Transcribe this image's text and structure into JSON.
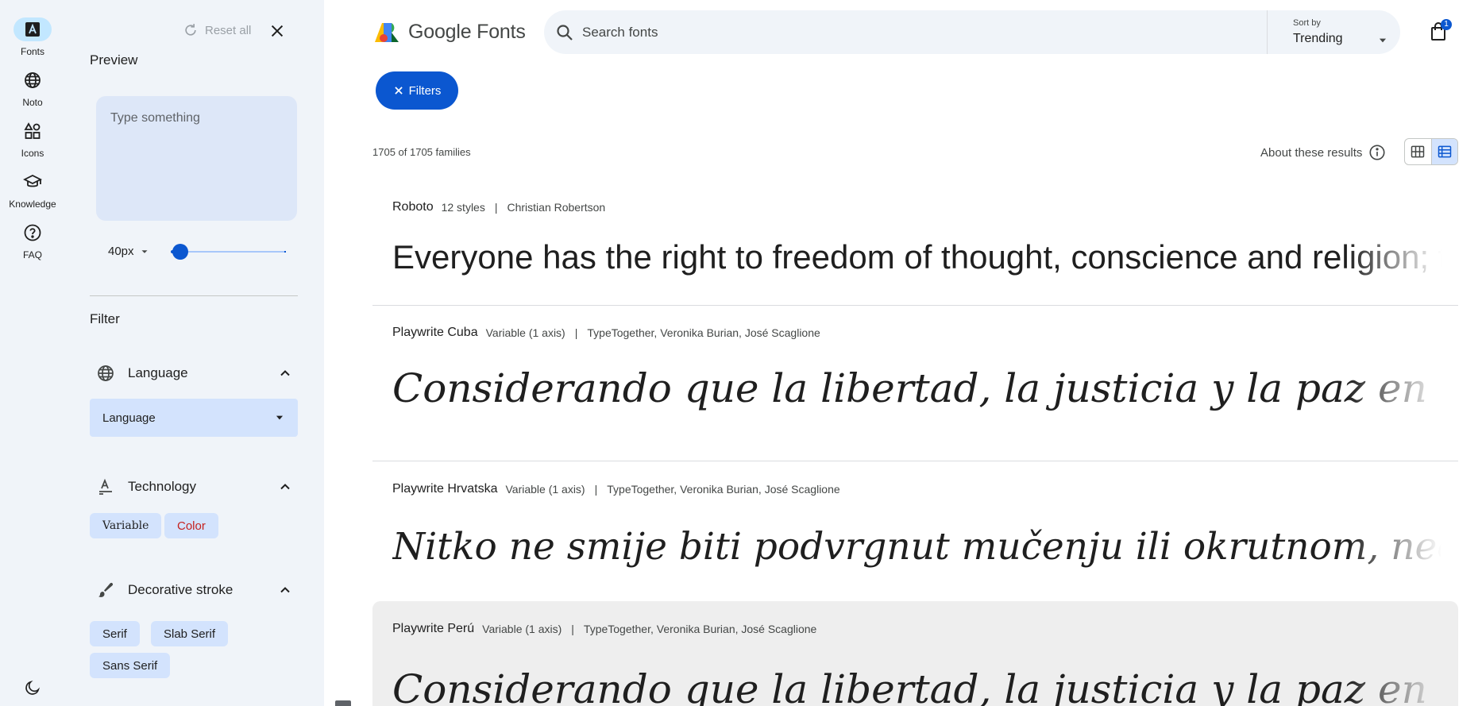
{
  "rail": {
    "items": [
      {
        "label": "Fonts",
        "icon": "fonts-icon",
        "active": true
      },
      {
        "label": "Noto",
        "icon": "globe-icon",
        "active": false
      },
      {
        "label": "Icons",
        "icon": "shapes-icon",
        "active": false
      },
      {
        "label": "Knowledge",
        "icon": "school-icon",
        "active": false
      },
      {
        "label": "FAQ",
        "icon": "help-icon",
        "active": false
      }
    ],
    "theme_icon": "dark-mode-icon"
  },
  "panel": {
    "reset_label": "Reset all",
    "preview_title": "Preview",
    "preview_placeholder": "Type something",
    "size_value": "40px",
    "size_slider_fraction": 0.08,
    "filter_title": "Filter",
    "language_section": "Language",
    "language_select": "Language",
    "technology_section": "Technology",
    "technology_chips": [
      "Variable",
      "Color"
    ],
    "decorative_section": "Decorative stroke",
    "decorative_chips": [
      "Serif",
      "Slab Serif",
      "Sans Serif"
    ]
  },
  "header": {
    "logo_text": "Google Fonts",
    "search_placeholder": "Search fonts",
    "sort_label": "Sort by",
    "sort_value": "Trending",
    "cart_count": "1"
  },
  "toolbar": {
    "filters_label": "Filters",
    "results_count": "1705 of 1705 families",
    "about_results": "About these results"
  },
  "fonts": [
    {
      "name": "Roboto",
      "styles": "12 styles",
      "designer": "Christian Robertson",
      "sample": "Everyone has the right to freedom of thought, conscience and religion; this right includes freedom to change"
    },
    {
      "name": "Playwrite Cuba",
      "styles": "Variable (1 axis)",
      "designer": "TypeTogether, Veronika Burian, José Scaglione",
      "sample": "Considerando que la libertad, la justicia y la paz en el mundo tienen"
    },
    {
      "name": "Playwrite Hrvatska",
      "styles": "Variable (1 axis)",
      "designer": "TypeTogether, Veronika Burian, José Scaglione",
      "sample": "Nitko ne smije biti podvrgnut mučenju ili okrutnom, nečovječnom"
    },
    {
      "name": "Playwrite Perú",
      "styles": "Variable (1 axis)",
      "designer": "TypeTogether, Veronika Burian, José Scaglione",
      "sample": "Considerando que la libertad, la justicia y la paz en el mundo tienen"
    }
  ],
  "colors": {
    "accent": "#0b57d0",
    "rail_bg": "#f0f4f9",
    "chip_bg": "#d3e3fd"
  }
}
